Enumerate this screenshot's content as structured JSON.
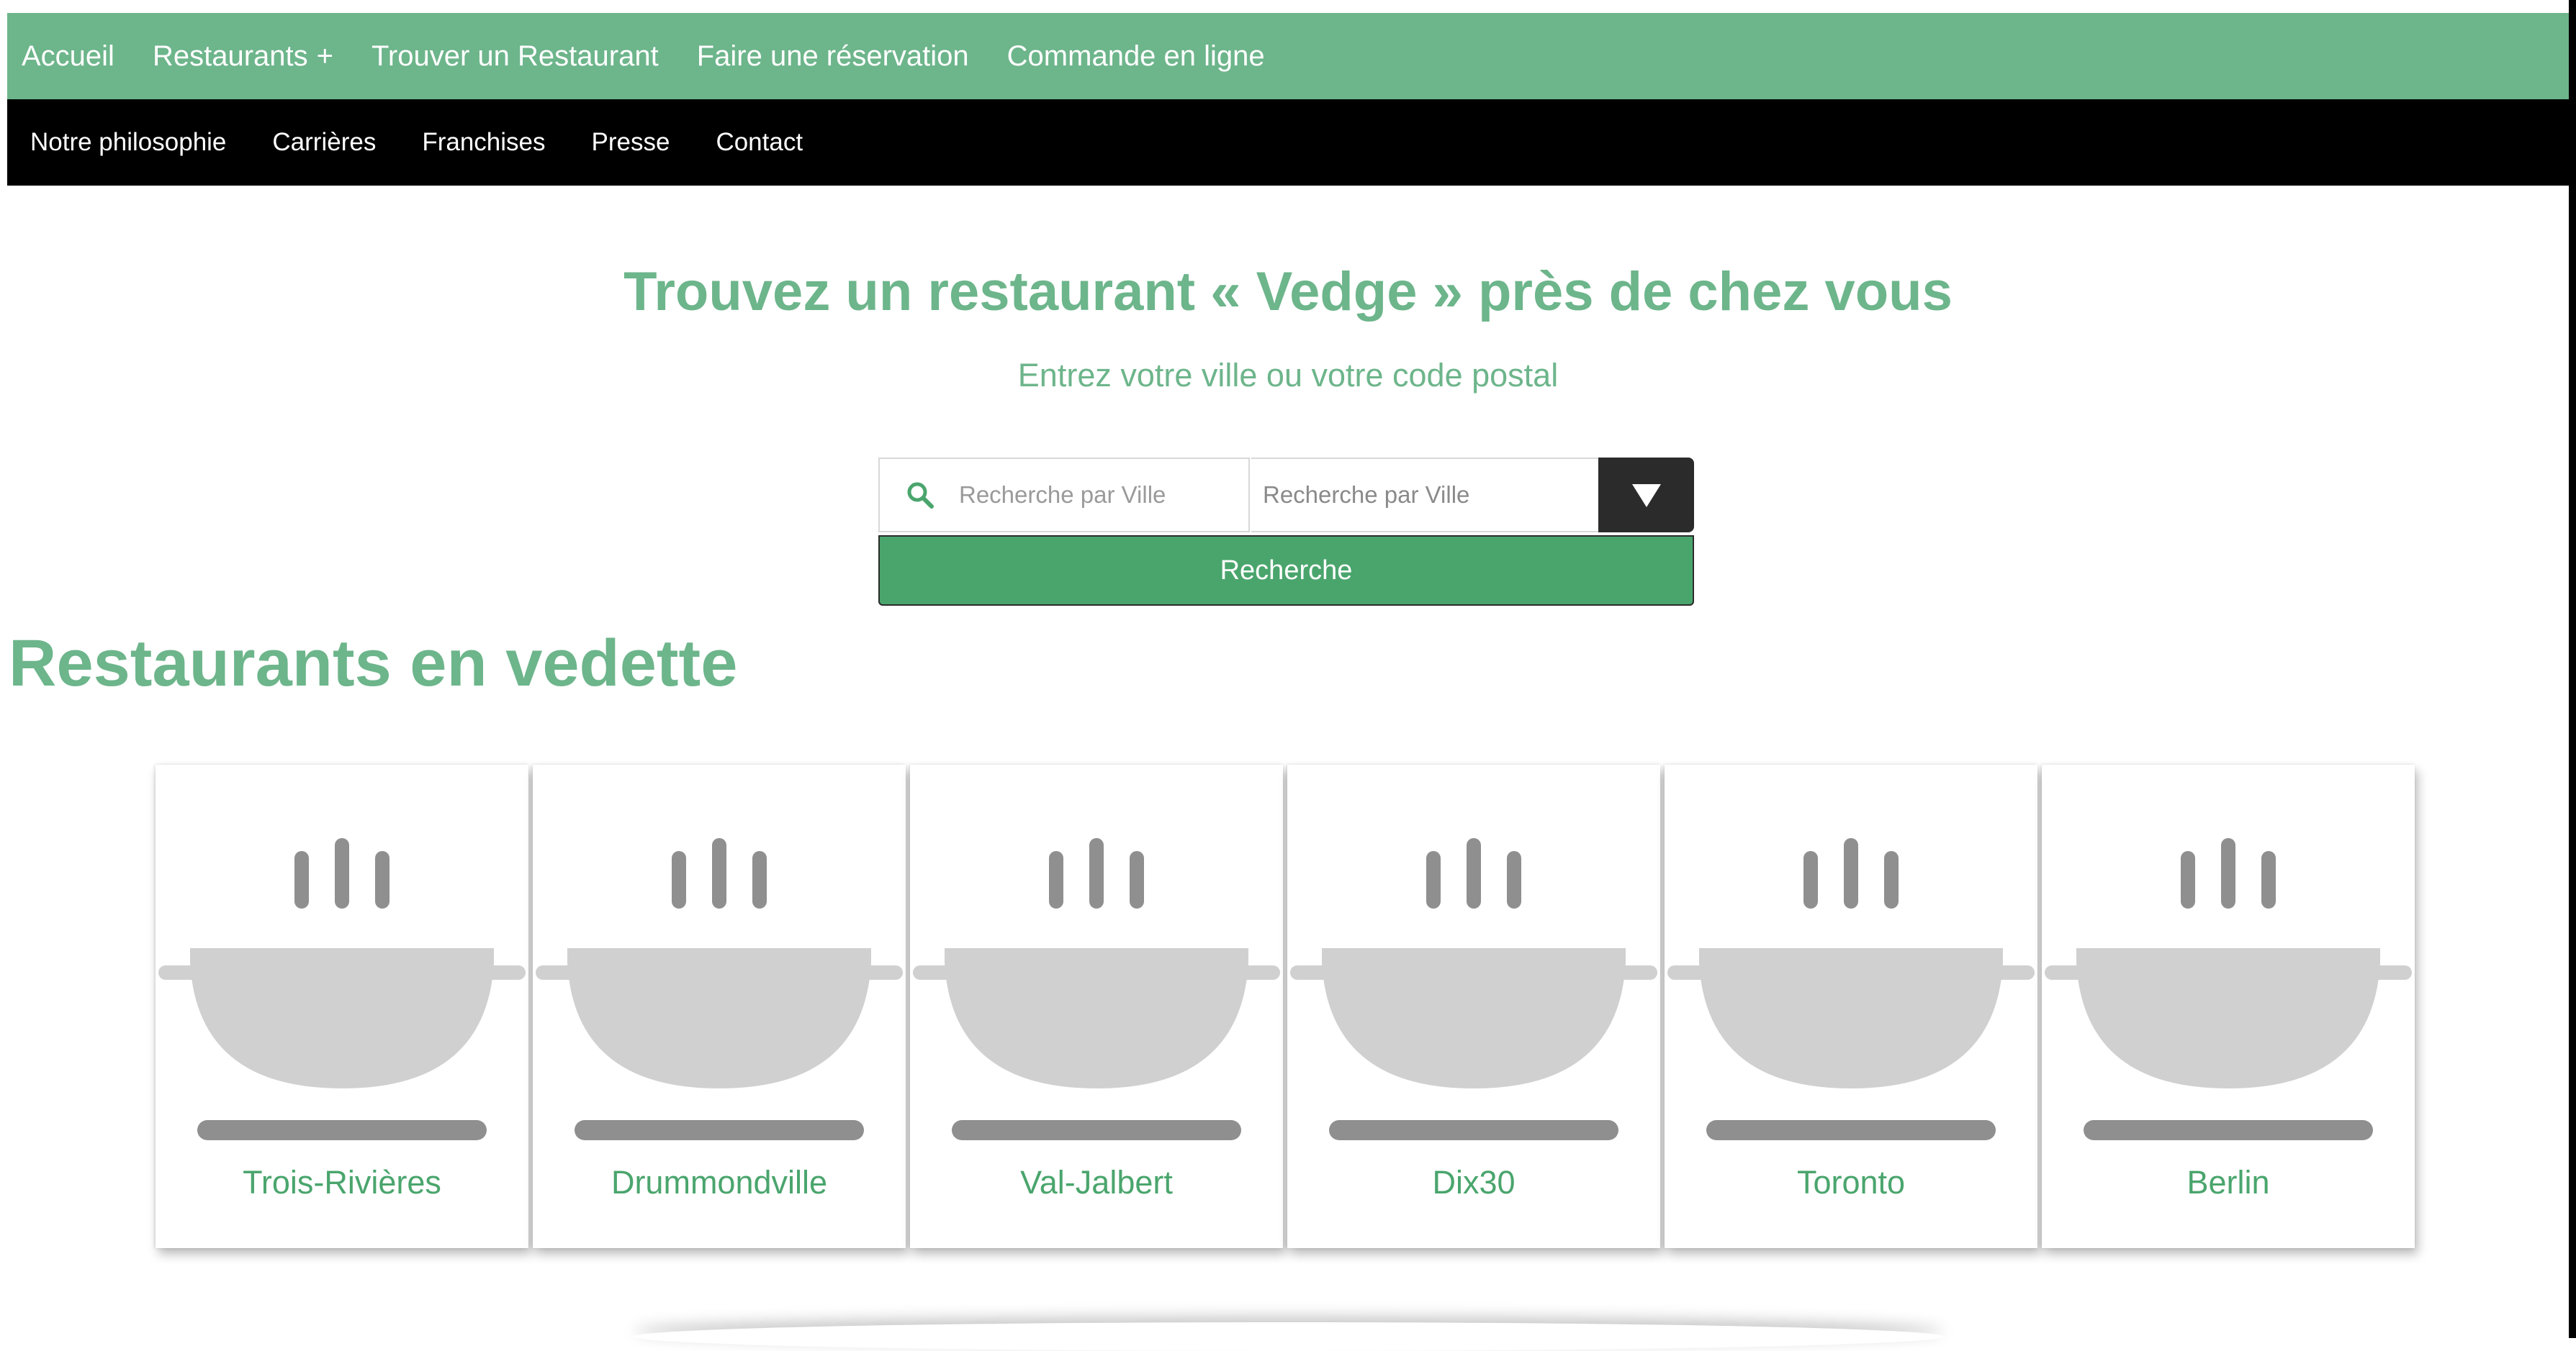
{
  "nav_primary": {
    "items": [
      {
        "label": "Accueil"
      },
      {
        "label": "Restaurants",
        "suffix": "+"
      },
      {
        "label": "Trouver un Restaurant"
      },
      {
        "label": "Faire une réservation"
      },
      {
        "label": "Commande en ligne"
      }
    ]
  },
  "nav_secondary": {
    "items": [
      {
        "label": "Notre philosophie"
      },
      {
        "label": "Carrières"
      },
      {
        "label": "Franchises"
      },
      {
        "label": "Presse"
      },
      {
        "label": "Contact"
      }
    ]
  },
  "hero": {
    "title": "Trouvez un restaurant « Vedge » près de chez vous",
    "subtitle": "Entrez votre ville ou votre code postal"
  },
  "search": {
    "city_placeholder": "Recherche par Ville",
    "select_value": "Recherche par Ville",
    "dropdown_glyph": "▼",
    "submit_label": "Recherche",
    "icon": "search-icon"
  },
  "featured": {
    "title": "Restaurants en vedette",
    "cards": [
      {
        "label": "Trois-Rivières",
        "icon": "cooking-pot-icon"
      },
      {
        "label": "Drummondville",
        "icon": "cooking-pot-icon"
      },
      {
        "label": "Val-Jalbert",
        "icon": "cooking-pot-icon"
      },
      {
        "label": "Dix30",
        "icon": "cooking-pot-icon"
      },
      {
        "label": "Toronto",
        "icon": "cooking-pot-icon"
      },
      {
        "label": "Berlin",
        "icon": "cooking-pot-icon"
      }
    ]
  },
  "colors": {
    "brand_green": "#6db58b",
    "button_green": "#4aa56d",
    "secondary_nav": "#000000",
    "dropdown_dark": "#2b2b2b",
    "pot_light": "#d0d0d0",
    "pot_dark": "#8f8f8f"
  }
}
